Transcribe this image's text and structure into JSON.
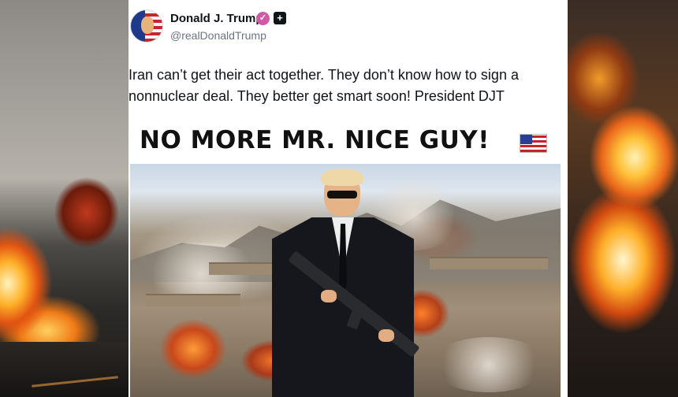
{
  "post": {
    "author_name": "Donald J. Trump",
    "handle": "@realDonaldTrump",
    "verified_badge_icon": "verified-badge-icon",
    "follow_icon": "plus-icon",
    "text_line1": "Iran can’t get their act together. They don’t know how to sign a",
    "text_line2": "nonnuclear deal. They better get smart soon! President DJT"
  },
  "image": {
    "headline": "NO MORE MR. NICE GUY!",
    "flag_icon": "us-flag-icon"
  },
  "colors": {
    "badge": "#d15aa6",
    "text": "#0f1419",
    "handle": "#6b7580"
  }
}
